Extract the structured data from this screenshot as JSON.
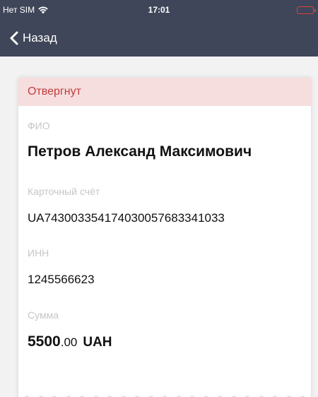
{
  "status_bar": {
    "carrier": "Нет SIM",
    "time": "17:01"
  },
  "nav": {
    "back_label": "Назад"
  },
  "card": {
    "status": "Отвергнут",
    "fields": {
      "fio": {
        "label": "ФИО",
        "value": "Петров Александ Максимович"
      },
      "account": {
        "label": "Карточный счёт",
        "value": "UA743003354174030057683341033"
      },
      "inn": {
        "label": "ИНН",
        "value": "1245566623"
      },
      "amount": {
        "label": "Сумма",
        "integer": "5500",
        "decimal": ".00",
        "currency": "UAH"
      }
    }
  },
  "colors": {
    "header_bg": "#3f4659",
    "status_banner_bg": "#f6dede",
    "status_text": "#c23b3b",
    "label_text": "#c6c6c6",
    "battery": "#e0403a"
  },
  "icons": {
    "wifi": "wifi-icon",
    "back": "chevron-left-icon",
    "battery": "battery-icon"
  }
}
